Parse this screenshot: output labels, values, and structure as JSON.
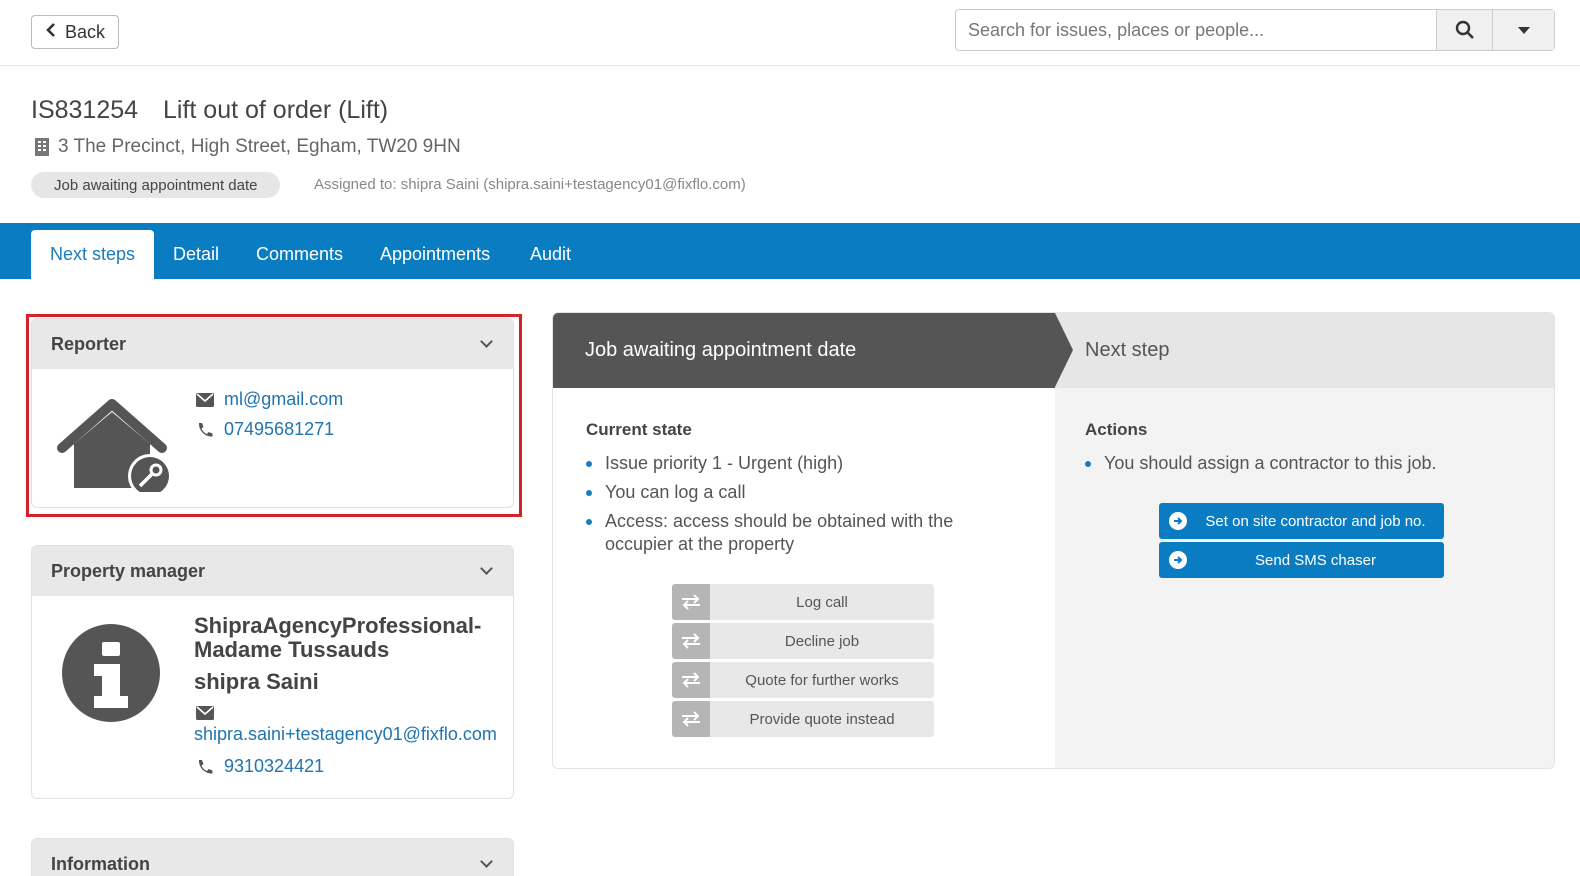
{
  "header": {
    "back_label": "Back",
    "search_placeholder": "Search for issues, places or people..."
  },
  "issue": {
    "id": "IS831254",
    "title": "Lift out of order (Lift)",
    "address": "3 The Precinct, High Street, Egham, TW20 9HN",
    "status": "Job awaiting appointment date",
    "assigned": "Assigned to: shipra Saini (shipra.saini+testagency01@fixflo.com)"
  },
  "tabs": [
    {
      "label": "Next steps",
      "active": true
    },
    {
      "label": "Detail"
    },
    {
      "label": "Comments"
    },
    {
      "label": "Appointments"
    },
    {
      "label": "Audit"
    }
  ],
  "reporter": {
    "title": "Reporter",
    "email": "ml@gmail.com",
    "phone": "07495681271"
  },
  "property_manager": {
    "title": "Property manager",
    "company": "ShipraAgencyProfessional-Madame Tussauds",
    "name": "shipra Saini",
    "email": "shipra.saini+testagency01@fixflo.com",
    "phone": "9310324421"
  },
  "information": {
    "title": "Information"
  },
  "status_panel": {
    "state_title": "Job awaiting appointment date",
    "next_title": "Next step",
    "current_state_label": "Current state",
    "current_state_items": [
      "Issue priority 1 - Urgent (high)",
      "You can log a call",
      "Access: access should be obtained with the occupier at the property"
    ],
    "action_buttons": [
      "Log call",
      "Decline job",
      "Quote for further works",
      "Provide quote instead"
    ],
    "actions_label": "Actions",
    "actions_items": [
      "You should assign a contractor to this job."
    ],
    "next_buttons": [
      "Set on site contractor and job no.",
      "Send SMS chaser"
    ]
  },
  "colors": {
    "brand_blue": "#0a7dc2",
    "dark_header": "#555555",
    "highlight_red": "#d6202a"
  }
}
